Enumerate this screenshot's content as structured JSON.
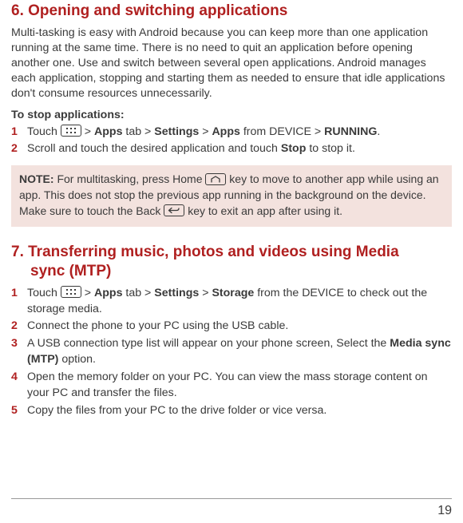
{
  "section6": {
    "heading": "6. Opening and switching applications",
    "intro": "Multi-tasking is easy with Android because you can keep more than one application running at the same time. There is no need to quit an application before opening another one. Use and switch between several open applications. Android manages each application, stopping and starting them as needed to ensure that idle applications don't consume resources unnecessarily.",
    "stopHeader": "To stop applications:",
    "step1": {
      "touch": "Touch ",
      "gt1": " > ",
      "apps": "Apps",
      "tab": " tab > ",
      "settings": "Settings",
      "gt2": " > ",
      "apps2": "Apps",
      "fromDevice": " from DEVICE > ",
      "running": "RUNNING",
      "period": "."
    },
    "step2_a": "Scroll and touch the desired application and touch ",
    "step2_stop": "Stop",
    "step2_b": " to stop it.",
    "note": {
      "label": "NOTE:",
      "a": " For multitasking, press Home ",
      "b": " key to move to another app while using an app. This does not stop the previous app running in the background on the device. Make sure to touch the Back ",
      "c": " key to exit an app after using it."
    }
  },
  "section7": {
    "heading_l1": "7. Transferring music, photos and videos using Media",
    "heading_l2": "sync (MTP)",
    "step1": {
      "touch": "Touch ",
      "gt1": " > ",
      "apps": "Apps",
      "tab": " tab > ",
      "settings": "Settings",
      "gt2": " > ",
      "storage": "Storage",
      "tail": " from the DEVICE to check out the storage media."
    },
    "step2": "Connect the phone to your PC using the USB cable.",
    "step3_a": "A USB connection type list will appear on your phone screen, Select the ",
    "step3_media": "Media sync (MTP)",
    "step3_b": " option.",
    "step4": "Open the memory folder on your PC. You can view the mass storage content on your PC and transfer the files.",
    "step5": "Copy the files from your PC to the drive folder or vice versa."
  },
  "nums": {
    "n1": "1",
    "n2": "2",
    "n3": "3",
    "n4": "4",
    "n5": "5"
  },
  "pageNumber": "19"
}
